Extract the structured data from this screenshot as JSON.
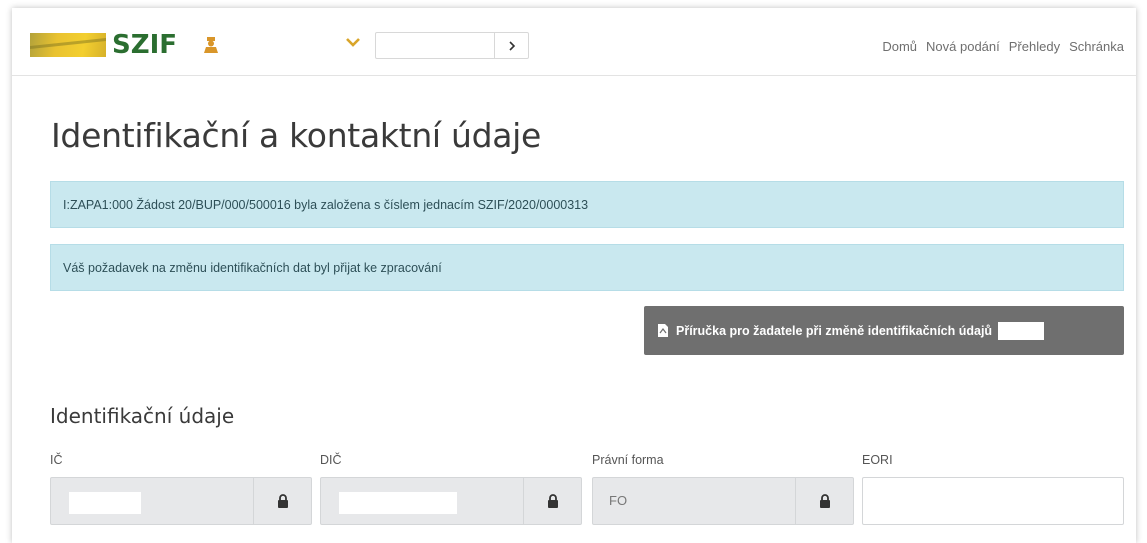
{
  "brand": {
    "name": "SZIF",
    "accent": "#2b6e30",
    "field_color": "#e9c230"
  },
  "header": {
    "select_value": "",
    "nav": [
      "Domů",
      "Nová podání",
      "Přehledy",
      "Schránka"
    ]
  },
  "page": {
    "title": "Identifikační a kontaktní údaje",
    "alerts": [
      "I:ZAPA1:000 Žádost 20/BUP/000/500016 byla založena s číslem jednacím SZIF/2020/0000313",
      "Váš požadavek na změnu identifikačních dat byl přijat ke zpracování"
    ],
    "doc_button": "Příručka pro žadatele při změně identifikačních údajů"
  },
  "ident": {
    "heading": "Identifikační údaje",
    "fields": [
      {
        "label": "IČ",
        "value": "",
        "locked": true
      },
      {
        "label": "DIČ",
        "value": "",
        "locked": true
      },
      {
        "label": "Právní forma",
        "value": "FO",
        "locked": true
      },
      {
        "label": "EORI",
        "value": "",
        "locked": false
      }
    ]
  },
  "colors": {
    "alert_bg": "#c9e8ef",
    "button_bg": "#6f6f6f",
    "readonly_bg": "#e7e8ea"
  }
}
